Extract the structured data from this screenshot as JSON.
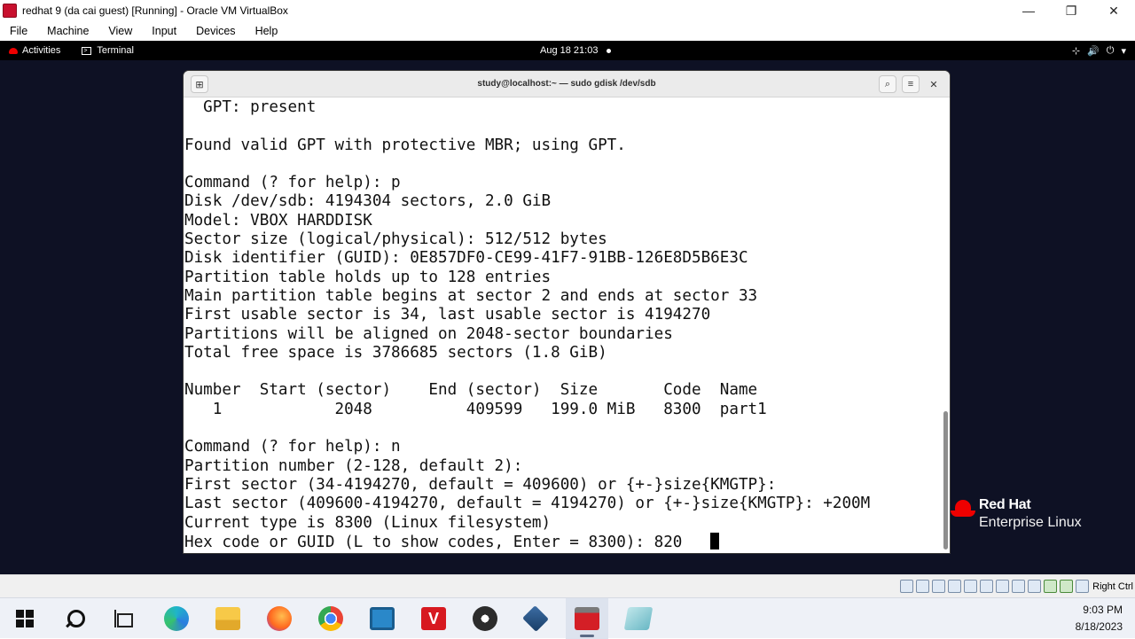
{
  "vbox": {
    "title": "redhat 9 (da cai guest) [Running] - Oracle VM VirtualBox",
    "window_buttons": {
      "minimize": "—",
      "restore": "❐",
      "close": "✕"
    },
    "menu": [
      "File",
      "Machine",
      "View",
      "Input",
      "Devices",
      "Help"
    ],
    "statusbar": {
      "host_key": "Right Ctrl"
    }
  },
  "gnome": {
    "activities": "Activities",
    "app_name": "Terminal",
    "clock": "Aug 18  21:03",
    "tray": {
      "network": "⊹",
      "volume": "🔊",
      "power": "⏻",
      "menu": "▾"
    }
  },
  "terminal": {
    "title": "study@localhost:~ — sudo gdisk /dev/sdb",
    "lines": [
      "  GPT: present",
      "",
      "Found valid GPT with protective MBR; using GPT.",
      "",
      "Command (? for help): p",
      "Disk /dev/sdb: 4194304 sectors, 2.0 GiB",
      "Model: VBOX HARDDISK",
      "Sector size (logical/physical): 512/512 bytes",
      "Disk identifier (GUID): 0E857DF0-CE99-41F7-91BB-126E8D5B6E3C",
      "Partition table holds up to 128 entries",
      "Main partition table begins at sector 2 and ends at sector 33",
      "First usable sector is 34, last usable sector is 4194270",
      "Partitions will be aligned on 2048-sector boundaries",
      "Total free space is 3786685 sectors (1.8 GiB)",
      "",
      "Number  Start (sector)    End (sector)  Size       Code  Name",
      "   1            2048          409599   199.0 MiB   8300  part1",
      "",
      "Command (? for help): n",
      "Partition number (2-128, default 2):",
      "First sector (34-4194270, default = 409600) or {+-}size{KMGTP}:",
      "Last sector (409600-4194270, default = 4194270) or {+-}size{KMGTP}: +200M",
      "Current type is 8300 (Linux filesystem)",
      "Hex code or GUID (L to show codes, Enter = 8300): 820   "
    ]
  },
  "redhat_logo": {
    "brand": "Red Hat",
    "product": "Enterprise Linux",
    "color": "#ee0000"
  },
  "taskbar": {
    "time": "9:03 PM",
    "date": "8/18/2023",
    "apps": [
      "start",
      "search",
      "task-view",
      "edge",
      "file-explorer",
      "firefox",
      "chrome",
      "app-blue",
      "app-red-v",
      "obs",
      "virtualbox",
      "app-vm-active",
      "app-notepad"
    ]
  },
  "colors": {
    "guest_bg": "#0e1124",
    "terminal_bg": "#ffffff",
    "accent_red": "#ee0000"
  }
}
